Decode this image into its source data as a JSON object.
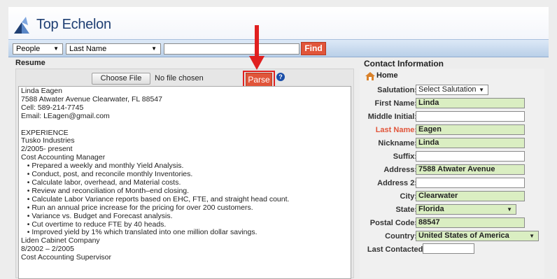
{
  "app": {
    "brand": "Top Echelon"
  },
  "search": {
    "category": "People",
    "field": "Last Name",
    "query": "",
    "find_label": "Find"
  },
  "resume": {
    "title": "Resume",
    "choose_file_label": "Choose File",
    "no_file_text": "No file chosen",
    "parse_label": "Parse",
    "help_label": "?",
    "text": "Linda Eagen\n7588 Atwater Avenue Clearwater, FL 88547\nCell: 589-214-7745\nEmail: LEagen@gmail.com\n\nEXPERIENCE\nTusko Industries\n2/2005- present\nCost Accounting Manager\n   • Prepared a weekly and monthly Yield Analysis.\n   • Conduct, post, and reconcile monthly Inventories.\n   • Calculate labor, overhead, and Material costs.\n   • Review and reconciliation of Month–end closing.\n   • Calculate Labor Variance reports based on EHC, FTE, and straight head count.\n   • Run an annual price increase for the pricing for over 200 customers.\n   • Variance vs. Budget and Forecast analysis.\n   • Cut overtime to reduce FTE by 40 heads.\n   • Improved yield by 1% which translated into one million dollar savings.\nLiden Cabinet Company\n8/2002 – 2/2005\nCost Accounting Supervisor"
  },
  "contact": {
    "title": "Contact Information",
    "section": "Home",
    "fields": {
      "salutation": {
        "label": "Salutation:",
        "value": "Select Salutation"
      },
      "first_name": {
        "label": "First Name:",
        "value": "Linda"
      },
      "middle_initial": {
        "label": "Middle Initial:",
        "value": ""
      },
      "last_name": {
        "label": "Last Name:",
        "value": "Eagen"
      },
      "nickname": {
        "label": "Nickname:",
        "value": "Linda"
      },
      "suffix": {
        "label": "Suffix:",
        "value": ""
      },
      "address": {
        "label": "Address:",
        "value": "7588 Atwater Avenue"
      },
      "address2": {
        "label": "Address 2:",
        "value": ""
      },
      "city": {
        "label": "City:",
        "value": "Clearwater"
      },
      "state": {
        "label": "State:",
        "value": "Florida"
      },
      "postal_code": {
        "label": "Postal Code:",
        "value": "88547"
      },
      "country": {
        "label": "Country:",
        "value": "United States of America"
      },
      "last_contacted": {
        "label": "Last Contacted:",
        "value": ""
      }
    }
  },
  "colors": {
    "accent": "#e1553a",
    "highlight_box": "#e02020",
    "filled_field": "#daeec2",
    "brand_blue": "#1f3f73"
  },
  "icons": [
    "logo-icon",
    "home-icon",
    "help-icon",
    "dropdown-caret-icon",
    "arrow-annotation"
  ]
}
